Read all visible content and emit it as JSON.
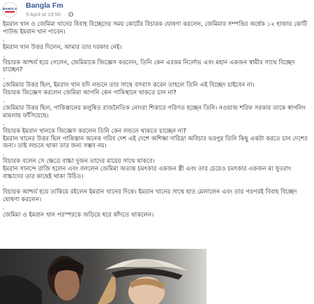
{
  "header": {
    "page_name": "Bangla Fm",
    "timestamp": "9 April at 19:50",
    "avatar_text": "BANGLA",
    "privacy_icon": "globe-icon"
  },
  "post": {
    "paragraphs": [
      "ইমরান খান ও জেমিমা খানের বিবাহ বিচ্ছেদের সময় কোর্টের বিচারক ঘোষণা করলেন, জেমিমার সম্পত্তির অর্ধেক ১২ হাজার কোটি পাউন্ড ইমরান খান পাবেন।",
      "ইমরান খান উত্তর দিলেন, আমার তার দরকার নেই।",
      "বিচারক আশ্চর্য হয়ে গেলেন, জেমিমাকে জিজ্ঞেস করলেন, তিনি কেন এরকম নির্লোভ এবং মহান একজন স্বামীর সাথে বিচ্ছেদ চাচ্ছেন?",
      "জেমিমার উত্তর ছিল, ইমরান খান যদি লন্ডনে তার সাথে বসবাস করেন তাহলে তিনি এই বিচ্ছেদ চাইবেন না।\nবিচারক জিজ্ঞেস করলেন জেমিমা আপনি কেন পাকিস্থানে থাকতে চান না?",
      "জেমিমার উত্তর ছিল, পাকিস্তানের কলুষিত রাজনৈতিক নোংরা শিকারে পরিণত হচ্ছেন তিনি। নওয়াজ শরিফ সরকার তাকে স্বাগলিং মামলায় ফাঁসিয়েছে।",
      "বিচারক ইমরান খানকে জিজ্ঞেস করলেন তিনি কেন লন্ডনে থাকতে চাচ্ছেন না?\nইমরান খানের উত্তর ছিল পাকিস্তান অনেক গরিব দেশ এই দেশে অশিক্ষা দারিদ্রা অবিচার ভরপুর তিনি কিছু একটা করতে চান দেশের জন্য। তাই লন্ডনে থাকা তার জন্য সম্ভব নয়।",
      "বিচারক বলেন সে ক্ষেত্রে বাচ্চা দুজন তাদের মায়ের সাথে থাকবে।\nইমরান সানন্দে রাজি হলেন এবং বললেন জেমিমা অত্যন্ত চমৎকার একজন স্ত্রী এবং তার চেয়েও চমৎকার একজন মা সুতরাং বাচ্চাদের তার কাছেই থাকা উচিত।",
      "বিচারক আশ্চর্য হয়ে তাকিয়ে রইলেন ইমরান খানের দিকে। ইমরান খানের সাথে হাত মেলালেন এবং তার পরপরই বিবাহ বিচ্ছেদ ঘোষণা করলেন।",
      "জেমিমা ও ইমরান খান পরস্পরকে জড়িয়ে ধরে কাঁদতে থাকলেন।"
    ],
    "separator": "."
  },
  "photo": {
    "icon": "photo-image"
  }
}
